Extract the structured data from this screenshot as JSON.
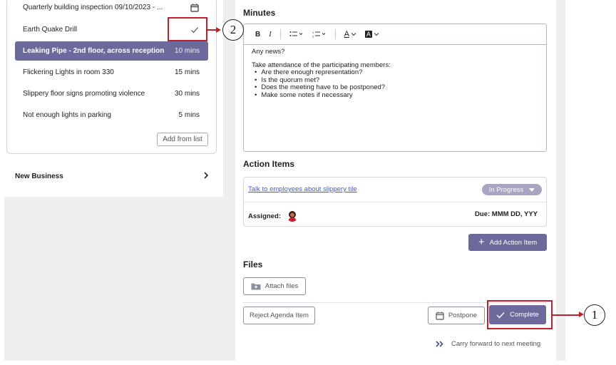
{
  "agenda": {
    "items": [
      {
        "title": "Quarterly building inspection 09/10/2023 - ...",
        "duration": "",
        "icon": "calendar-icon"
      },
      {
        "title": "Earth Quake Drill",
        "duration": "",
        "icon": "check-icon"
      },
      {
        "title": "Leaking Pipe - 2nd floor, across reception",
        "duration": "10 mins",
        "selected": true
      },
      {
        "title": "Flickering Lights in room 330",
        "duration": "15 mins"
      },
      {
        "title": "Slippery floor signs promoting violence",
        "duration": "30 mins"
      },
      {
        "title": "Not enough lights in parking",
        "duration": "5 mins"
      }
    ],
    "add_from_list": "Add from list"
  },
  "new_business": {
    "label": "New Business",
    "icon": "chevron-right-icon"
  },
  "minutes": {
    "title": "Minutes",
    "toolbar": {
      "bold": "B",
      "italic": "I",
      "font_color": "A",
      "highlight": "A"
    },
    "body": {
      "line1": "Any news?",
      "line2": "Take attendance of the participating members:",
      "bullets": [
        "Are there enough representation?",
        "Is the quorum met?",
        "Does the meeting have to be postponed?",
        "Make some notes if necessary"
      ]
    }
  },
  "action_items": {
    "title": "Action Items",
    "item": {
      "link": "Talk to employees about slippery tile",
      "status": "In Progress",
      "assigned_label": "Assigned:",
      "due": "Due: MMM DD, YYY"
    },
    "add_button": "Add Action Item"
  },
  "files": {
    "title": "Files",
    "attach": "Attach files"
  },
  "actions": {
    "reject": "Reject Agenda Item",
    "postpone": "Postpone",
    "complete": "Complete",
    "carry_forward": "Carry forward to next meeting"
  },
  "callouts": {
    "one": "1",
    "two": "2"
  },
  "colors": {
    "accent": "#6c6a9a",
    "callout": "#c0202b",
    "link": "#3a5fcf"
  }
}
